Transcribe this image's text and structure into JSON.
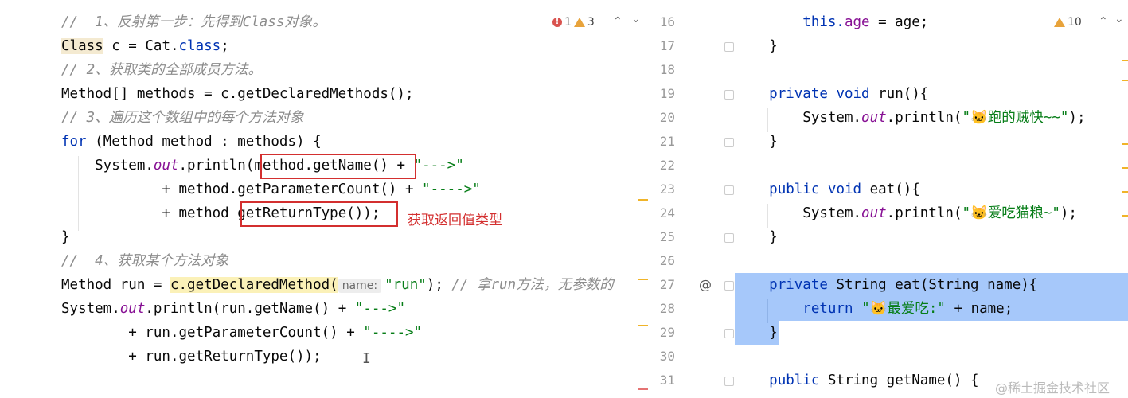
{
  "left_editor": {
    "status": {
      "errors": "1",
      "warnings": "3"
    },
    "lines": {
      "l1_comment": "//  1、反射第一步：先得到Class对象。",
      "l2_a": "Class",
      "l2_b": " c = Cat.",
      "l2_c": "class",
      "l2_d": ";",
      "l3_comment": "// 2、获取类的全部成员方法。",
      "l4": "Method[] methods = c.getDeclaredMethods();",
      "l5_comment": "// 3、遍历这个数组中的每个方法对象",
      "l6_kw": "for",
      "l6_rest": " (Method method : methods) {",
      "l7_a": "    System.",
      "l7_b": "out",
      "l7_c": ".println(method.getName() + ",
      "l7_d": "\"--->\"",
      "l8_a": "            + method.getParameterCount() + ",
      "l8_b": "\"---->\"",
      "l9_a": "            + method ",
      "l9_b": "getReturnType());",
      "l10": "}",
      "l11_comment": "//  4、获取某个方法对象",
      "l12_a": "Method run = ",
      "l12_b": "c.getDeclaredMethod(",
      "l12_hint": "name:",
      "l12_c": "\"run\"",
      "l12_d": "); ",
      "l12_e": "// 拿run方法，无参数的",
      "l13_a": "System.",
      "l13_b": "out",
      "l13_c": ".println(run.getName() + ",
      "l13_d": "\"--->\"",
      "l14_a": "        + run.getParameterCount() + ",
      "l14_b": "\"---->\"",
      "l15": "        + run.getReturnType());"
    },
    "annotation": "获取返回值类型"
  },
  "right_editor": {
    "status": {
      "warnings": "10"
    },
    "line_numbers": [
      "16",
      "17",
      "18",
      "19",
      "20",
      "21",
      "22",
      "23",
      "24",
      "25",
      "26",
      "27",
      "28",
      "29",
      "30",
      "31"
    ],
    "lines": {
      "r16_a": "        this.",
      "r16_b": "age",
      "r16_c": " = age;",
      "r17": "    }",
      "r19_a": "    ",
      "r19_kw": "private void",
      "r19_b": " run(){",
      "r20_a": "        System.",
      "r20_b": "out",
      "r20_c": ".println(",
      "r20_d": "\"🐱跑的贼快~~\"",
      "r20_e": ");",
      "r21": "    }",
      "r23_a": "    ",
      "r23_kw": "public void",
      "r23_b": " eat(){",
      "r24_a": "        System.",
      "r24_b": "out",
      "r24_c": ".println(",
      "r24_d": "\"🐱爱吃猫粮~\"",
      "r24_e": ");",
      "r25": "    }",
      "r27_a": "    ",
      "r27_kw": "private",
      "r27_b": " String eat(String name){",
      "r28_a": "        ",
      "r28_kw": "return",
      "r28_b": " ",
      "r28_c": "\"🐱最爱吃:\"",
      "r28_d": " + name;",
      "r29": "    }",
      "r31_a": "    ",
      "r31_kw": "public",
      "r31_b": " String getName() {"
    }
  },
  "watermark": "@稀土掘金技术社区",
  "colors": {
    "keyword": "#0033b3",
    "string": "#067d17",
    "comment": "#8c8c8c",
    "selection": "#a6c8fa",
    "annotation": "#d32f2f"
  }
}
